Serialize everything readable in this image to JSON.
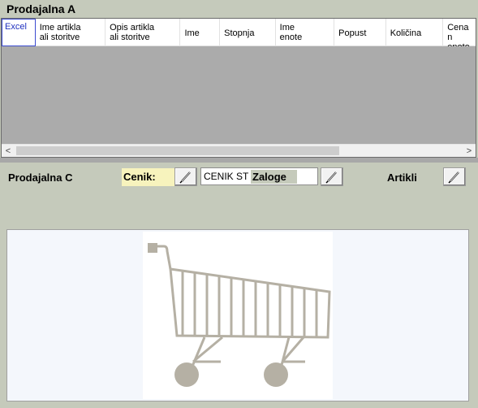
{
  "top_panel": {
    "title": "Prodajalna A",
    "columns": [
      "Excel",
      "Ime artikla\nali storitve",
      "Opis artikla\nali storitve",
      "Ime",
      "Stopnja",
      "Ime\nenote",
      "Popust",
      "Količina",
      "Cena n\nenoto"
    ],
    "scroll_left": "<",
    "scroll_right": ">"
  },
  "bottom_panel": {
    "title": "Prodajalna C",
    "cenik_label": "Cenik:",
    "cenik_value": "CENIK ST",
    "zaloge_label": "Zaloge",
    "artikli_label": "Artikli"
  },
  "icons": {
    "edit": "pencil-icon",
    "cart": "shopping-cart-icon"
  },
  "colors": {
    "background": "#c5cabb",
    "highlight": "#f7f3bd",
    "grid_empty": "#ababab",
    "cart": "#b5b0a4"
  }
}
